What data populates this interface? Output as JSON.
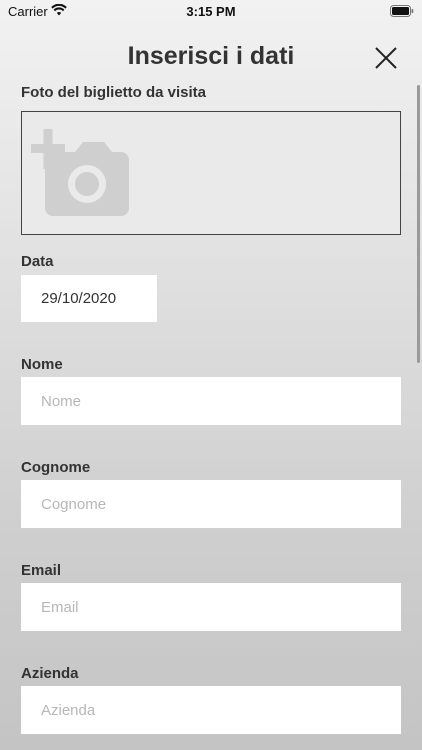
{
  "status_bar": {
    "carrier": "Carrier",
    "time": "3:15 PM",
    "wifi_icon": "wifi-icon",
    "battery_icon": "battery-icon"
  },
  "header": {
    "title": "Inserisci i dati",
    "close_icon": "close-icon"
  },
  "form": {
    "photo": {
      "label": "Foto del biglietto da visita",
      "icon": "add-photo-icon"
    },
    "date": {
      "label": "Data",
      "value": "29/10/2020"
    },
    "first_name": {
      "label": "Nome",
      "placeholder": "Nome"
    },
    "last_name": {
      "label": "Cognome",
      "placeholder": "Cognome"
    },
    "email": {
      "label": "Email",
      "placeholder": "Email"
    },
    "company": {
      "label": "Azienda",
      "placeholder": "Azienda"
    }
  },
  "colors": {
    "label_text": "#333333",
    "placeholder_text": "#b7b7b7",
    "icon_gray": "#cfcfcf",
    "field_background": "#ffffff"
  }
}
